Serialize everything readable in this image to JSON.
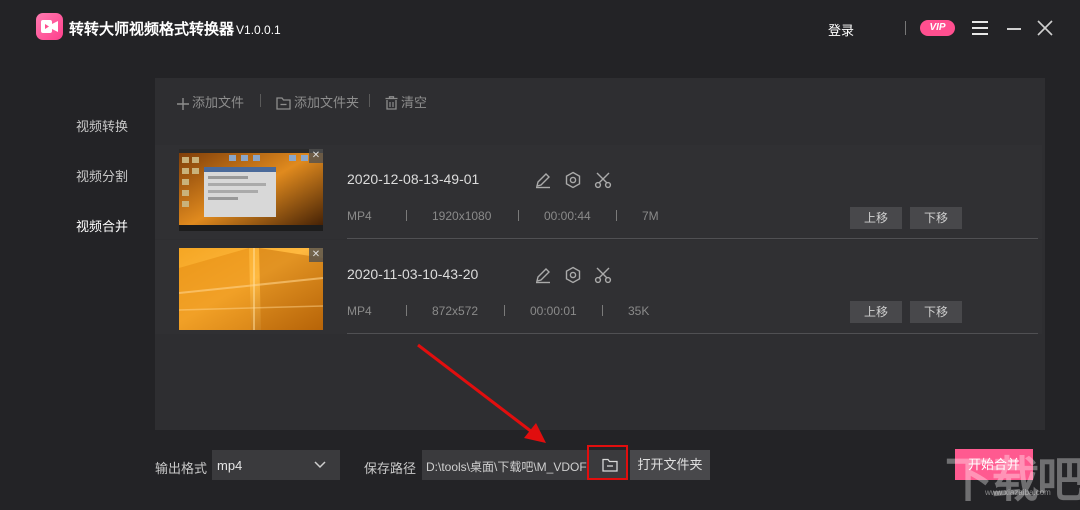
{
  "app": {
    "title": "转转大师视频格式转换器",
    "version": "V1.0.0.1",
    "login_label": "登录",
    "vip_label": "VIP"
  },
  "sidebar": {
    "items": [
      {
        "label": "视频转换"
      },
      {
        "label": "视频分割"
      },
      {
        "label": "视频合并"
      }
    ]
  },
  "toolbar": {
    "add_file": "添加文件",
    "add_folder": "添加文件夹",
    "clear": "清空"
  },
  "files": [
    {
      "name": "2020-12-08-13-49-01",
      "format": "MP4",
      "resolution": "1920x1080",
      "duration": "00:00:44",
      "size": "7M",
      "up_label": "上移",
      "down_label": "下移"
    },
    {
      "name": "2020-11-03-10-43-20",
      "format": "MP4",
      "resolution": "872x572",
      "duration": "00:00:01",
      "size": "35K",
      "up_label": "上移",
      "down_label": "下移"
    }
  ],
  "footer": {
    "output_format_label": "输出格式",
    "output_format_value": "mp4",
    "save_path_label": "保存路径",
    "save_path_value": "D:\\tools\\桌面\\下载吧\\M_VDOF",
    "open_folder_label": "打开文件夹",
    "start_label": "开始合并"
  },
  "watermark": {
    "text": "下载吧",
    "sub": "www.xiazaiba.com"
  },
  "colors": {
    "accent": "#ff5a90",
    "background": "#232326",
    "panel": "#2e2e31",
    "highlight": "#e10e0e"
  }
}
